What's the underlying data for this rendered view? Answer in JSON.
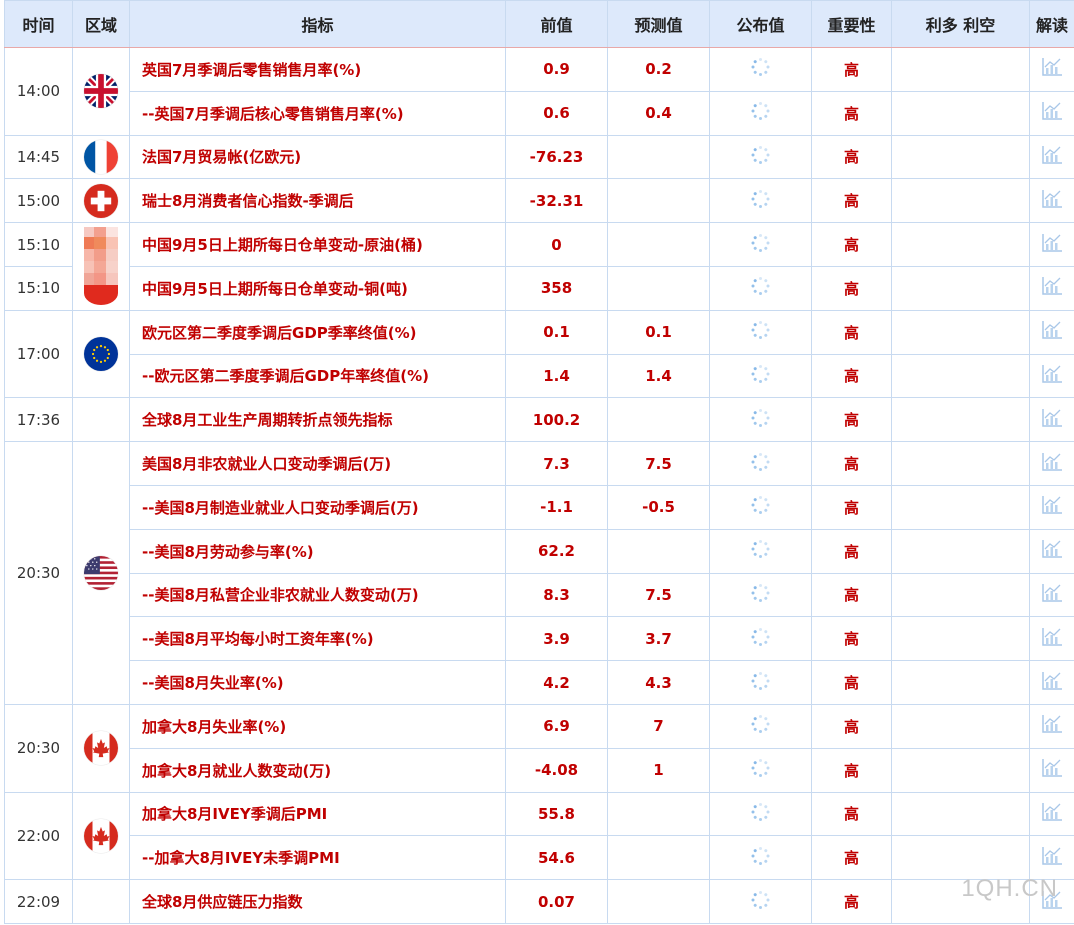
{
  "headers": {
    "time": "时间",
    "region": "区域",
    "indicator": "指标",
    "previous": "前值",
    "forecast": "预测值",
    "actual": "公布值",
    "importance": "重要性",
    "impact": "利多 利空",
    "analysis": "解读"
  },
  "rows": [
    {
      "time": "14:00",
      "indicator": "英国7月季调后零售销售月率(%)",
      "previous": "0.9",
      "forecast": "0.2",
      "importance": "高"
    },
    {
      "time": "",
      "indicator": "--英国7月季调后核心零售销售月率(%)",
      "previous": "0.6",
      "forecast": "0.4",
      "importance": "高"
    },
    {
      "time": "14:45",
      "indicator": "法国7月贸易帐(亿欧元)",
      "previous": "-76.23",
      "forecast": "",
      "importance": "高"
    },
    {
      "time": "15:00",
      "indicator": "瑞士8月消费者信心指数-季调后",
      "previous": "-32.31",
      "forecast": "",
      "importance": "高"
    },
    {
      "time": "15:10",
      "indicator": "中国9月5日上期所每日仓单变动-原油(桶)",
      "previous": "0",
      "forecast": "",
      "importance": "高"
    },
    {
      "time": "15:10",
      "indicator": "中国9月5日上期所每日仓单变动-铜(吨)",
      "previous": "358",
      "forecast": "",
      "importance": "高"
    },
    {
      "time": "17:00",
      "indicator": "欧元区第二季度季调后GDP季率终值(%)",
      "previous": "0.1",
      "forecast": "0.1",
      "importance": "高"
    },
    {
      "time": "",
      "indicator": "--欧元区第二季度季调后GDP年率终值(%)",
      "previous": "1.4",
      "forecast": "1.4",
      "importance": "高"
    },
    {
      "time": "17:36",
      "indicator": "全球8月工业生产周期转折点领先指标",
      "previous": "100.2",
      "forecast": "",
      "importance": "高"
    },
    {
      "time": "20:30",
      "indicator": "美国8月非农就业人口变动季调后(万)",
      "previous": "7.3",
      "forecast": "7.5",
      "importance": "高"
    },
    {
      "time": "",
      "indicator": "--美国8月制造业就业人口变动季调后(万)",
      "previous": "-1.1",
      "forecast": "-0.5",
      "importance": "高"
    },
    {
      "time": "",
      "indicator": "--美国8月劳动参与率(%)",
      "previous": "62.2",
      "forecast": "",
      "importance": "高"
    },
    {
      "time": "",
      "indicator": "--美国8月私营企业非农就业人数变动(万)",
      "previous": "8.3",
      "forecast": "7.5",
      "importance": "高"
    },
    {
      "time": "",
      "indicator": "--美国8月平均每小时工资年率(%)",
      "previous": "3.9",
      "forecast": "3.7",
      "importance": "高"
    },
    {
      "time": "",
      "indicator": "--美国8月失业率(%)",
      "previous": "4.2",
      "forecast": "4.3",
      "importance": "高"
    },
    {
      "time": "20:30",
      "indicator": "加拿大8月失业率(%)",
      "previous": "6.9",
      "forecast": "7",
      "importance": "高"
    },
    {
      "time": "",
      "indicator": "加拿大8月就业人数变动(万)",
      "previous": "-4.08",
      "forecast": "1",
      "importance": "高"
    },
    {
      "time": "22:00",
      "indicator": "加拿大8月IVEY季调后PMI",
      "previous": "55.8",
      "forecast": "",
      "importance": "高"
    },
    {
      "time": "",
      "indicator": "--加拿大8月IVEY未季调PMI",
      "previous": "54.6",
      "forecast": "",
      "importance": "高"
    },
    {
      "time": "22:09",
      "indicator": "全球8月供应链压力指数",
      "previous": "0.07",
      "forecast": "",
      "importance": "高"
    }
  ],
  "watermark": "1QH.CN",
  "colors": {
    "value_red": "#c00000",
    "header_bg": "#dde9fb",
    "border": "#c8daf0"
  }
}
